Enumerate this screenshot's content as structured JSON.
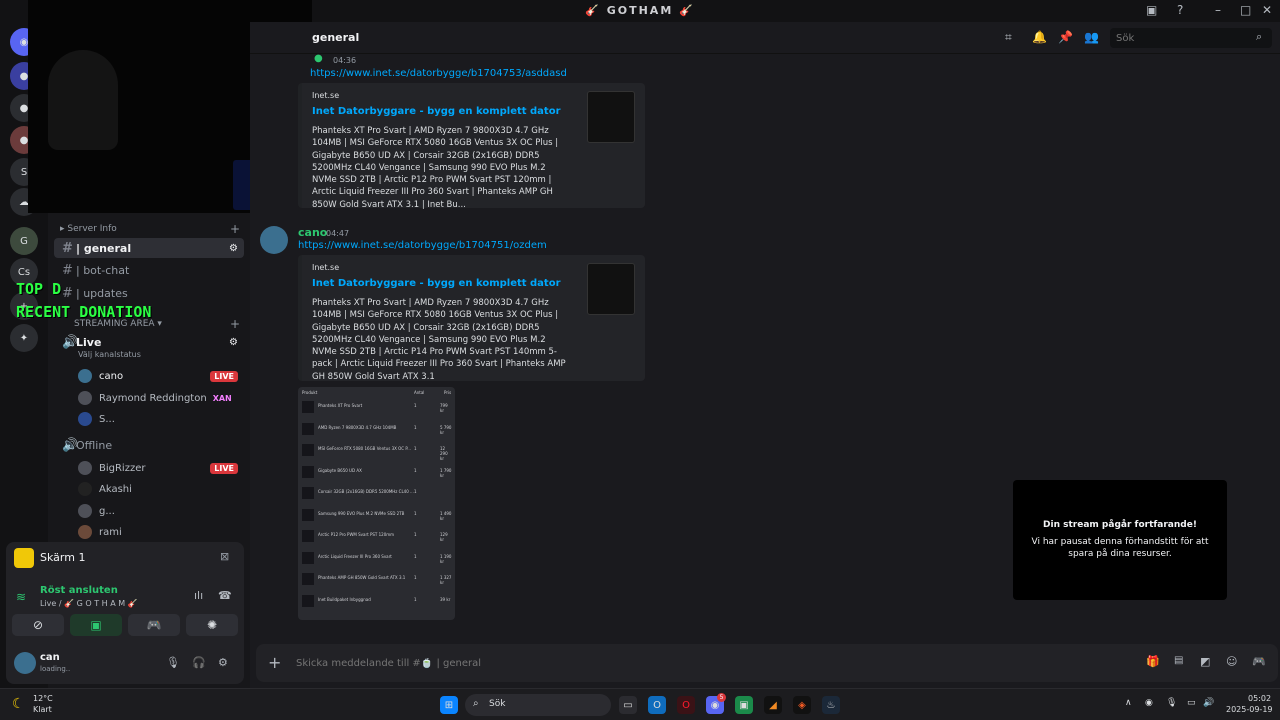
{
  "window": {
    "title": "🎸 GOTHAM 🎸"
  },
  "rail": {
    "server_cs": "Cs",
    "server_s": "S"
  },
  "sidebar": {
    "cat_server_info": "Server Info",
    "channels": [
      {
        "name": "| general"
      },
      {
        "name": "| bot-chat"
      },
      {
        "name": "| updates"
      }
    ],
    "cat_streaming": "STREAMING AREA",
    "voice_live": "Live",
    "voice_live_status": "Välj kanalstatus",
    "live_users": [
      {
        "name": "cano",
        "badge": "LIVE"
      },
      {
        "name": "Raymond Reddington",
        "tag": "XAN"
      },
      {
        "name": "S..."
      }
    ],
    "voice_offline": "Offline",
    "offline_users": [
      {
        "name": "BigRizzer",
        "badge": "LIVE"
      },
      {
        "name": "Akashi"
      },
      {
        "name": "g..."
      },
      {
        "name": "rami"
      }
    ]
  },
  "overlay": {
    "top": "TOP D",
    "recent": "RECENT DONATION"
  },
  "panel": {
    "screen_label": "Skärm 1",
    "voice_connected": "Röst ansluten",
    "voice_channel": "Live / 🎸 G O T H A M 🎸",
    "user_name": "can",
    "user_status": "loading.."
  },
  "chat": {
    "channel_name": "general",
    "search_placeholder": "Sök",
    "msg1": {
      "time": "04:36",
      "link": "https://www.inet.se/datorbygge/b1704753/asddasd",
      "site": "Inet.se",
      "title": "Inet Datorbyggare - bygg en komplett dator",
      "desc": "Phanteks XT Pro Svart | AMD Ryzen 7 9800X3D 4.7 GHz 104MB | MSI GeForce RTX 5080 16GB Ventus 3X OC Plus | Gigabyte B650 UD AX | Corsair 32GB (2x16GB) DDR5 5200MHz CL40 Vengance | Samsung 990 EVO Plus M.2 NVMe SSD 2TB | Arctic P12 Pro PWM Svart PST 120mm | Arctic Liquid Freezer III Pro 360 Svart | Phanteks AMP GH 850W Gold Svart ATX 3.1 | Inet Bu..."
    },
    "msg2": {
      "user": "cano",
      "time": "04:47",
      "link": "https://www.inet.se/datorbygge/b1704751/ozdem",
      "site": "Inet.se",
      "title": "Inet Datorbyggare - bygg en komplett dator",
      "desc": "Phanteks XT Pro Svart | AMD Ryzen 7 9800X3D 4.7 GHz 104MB | MSI GeForce RTX 5080 16GB Ventus 3X OC Plus | Gigabyte B650 UD AX | Corsair 32GB (2x16GB) DDR5 5200MHz CL40 Vengance | Samsung 990 EVO Plus M.2 NVMe SSD 2TB | Arctic P14 Pro PWM Svart PST 140mm 5-pack | Arctic Liquid Freezer III Pro 360 Svart | Phanteks AMP GH 850W Gold Svart ATX 3.1"
    },
    "table": {
      "headers": [
        "Produkt",
        "Antal",
        "Pris"
      ],
      "rows": [
        {
          "name": "Phanteks XT Pro Svart",
          "qty": "1",
          "price": "799 kr"
        },
        {
          "name": "AMD Ryzen 7 9800X3D 4.7 GHz 104MB",
          "qty": "1",
          "price": "5 790 kr"
        },
        {
          "name": "MSI GeForce RTX 5080 16GB Ventus 3X OC P...",
          "qty": "1",
          "price": "12 290 kr"
        },
        {
          "name": "Gigabyte B650 UD AX",
          "qty": "1",
          "price": "1 790 kr"
        },
        {
          "name": "Corsair 32GB (2x16GB) DDR5 5200MHz CL40 ...",
          "qty": "1",
          "price": ""
        },
        {
          "name": "Samsung 990 EVO Plus M.2 NVMe SSD 2TB",
          "qty": "1",
          "price": "1 490 kr"
        },
        {
          "name": "Arctic P12 Pro PWM Svart PST 120mm",
          "qty": "1",
          "price": "129 kr"
        },
        {
          "name": "Arctic Liquid Freezer III Pro 360 Svart",
          "qty": "1",
          "price": "1 190 kr"
        },
        {
          "name": "Phanteks AMP GH 850W Gold Svart ATX 3.1",
          "qty": "1",
          "price": "1 327 kr"
        },
        {
          "name": "Inet Buildpaket Inbyggnad",
          "qty": "1",
          "price": "39 kr"
        }
      ]
    },
    "input_placeholder": "Skicka meddelande till #🍵 | general",
    "stream_card": {
      "title": "Din stream pågår fortfarande!",
      "desc": "Vi har pausat denna förhandstitt för att spara på dina resurser."
    }
  },
  "taskbar": {
    "temp": "12°C",
    "weather": "Klart",
    "search_placeholder": "Sök",
    "time": "05:02",
    "date": "2025-09-19",
    "discord_badge": "5"
  }
}
